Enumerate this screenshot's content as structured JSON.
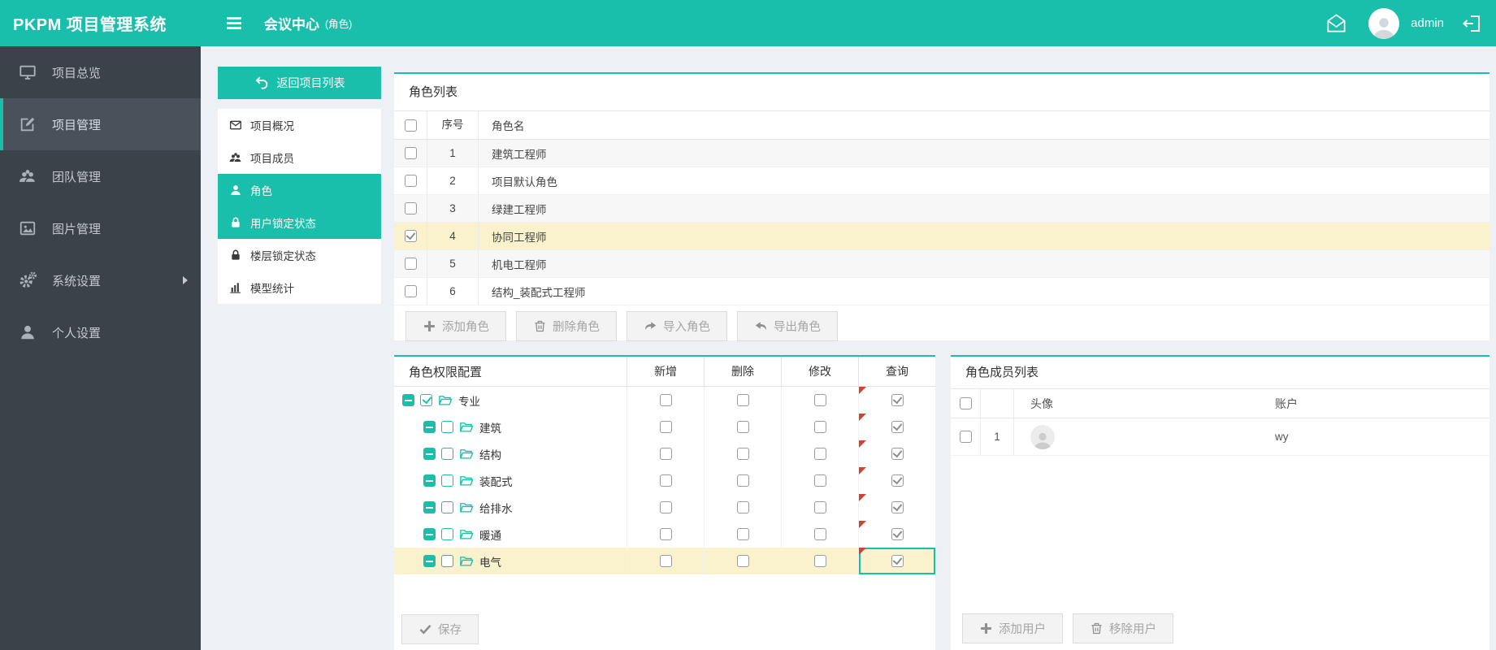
{
  "colors": {
    "accent": "#1abfab",
    "sidebar_bg": "#3b424a",
    "row_highlight": "#faf2cc",
    "flag_red": "#d2432f"
  },
  "topbar": {
    "brand": "PKPM 项目管理系统",
    "title": "会议中心",
    "title_suffix": "(角色)",
    "username": "admin"
  },
  "sidebar": {
    "items": [
      {
        "label": "项目总览",
        "icon": "monitor",
        "active": false,
        "has_submenu": false
      },
      {
        "label": "项目管理",
        "icon": "edit",
        "active": true,
        "has_submenu": false
      },
      {
        "label": "团队管理",
        "icon": "team",
        "active": false,
        "has_submenu": false
      },
      {
        "label": "图片管理",
        "icon": "image",
        "active": false,
        "has_submenu": false
      },
      {
        "label": "系统设置",
        "icon": "gears",
        "active": false,
        "has_submenu": true
      },
      {
        "label": "个人设置",
        "icon": "user",
        "active": false,
        "has_submenu": false
      }
    ]
  },
  "submenu": {
    "back_label": "返回项目列表",
    "items": [
      {
        "label": "项目概况",
        "icon": "mail",
        "active": false
      },
      {
        "label": "项目成员",
        "icon": "team",
        "active": false
      },
      {
        "label": "角色",
        "icon": "user",
        "active": true
      },
      {
        "label": "用户锁定状态",
        "icon": "lock",
        "active": true
      },
      {
        "label": "楼层锁定状态",
        "icon": "lock",
        "active": false
      },
      {
        "label": "模型统计",
        "icon": "chart",
        "active": false
      }
    ]
  },
  "role_list": {
    "title": "角色列表",
    "columns": [
      "序号",
      "角色名"
    ],
    "rows": [
      {
        "no": "1",
        "name": "建筑工程师",
        "checked": false,
        "selected": false
      },
      {
        "no": "2",
        "name": "项目默认角色",
        "checked": false,
        "selected": false
      },
      {
        "no": "3",
        "name": "绿建工程师",
        "checked": false,
        "selected": false
      },
      {
        "no": "4",
        "name": "协同工程师",
        "checked": true,
        "selected": true
      },
      {
        "no": "5",
        "name": "机电工程师",
        "checked": false,
        "selected": false
      },
      {
        "no": "6",
        "name": "结构_装配式工程师",
        "checked": false,
        "selected": false
      }
    ],
    "buttons": [
      {
        "label": "添加角色",
        "icon": "plus"
      },
      {
        "label": "删除角色",
        "icon": "trash"
      },
      {
        "label": "导入角色",
        "icon": "arrow-import"
      },
      {
        "label": "导出角色",
        "icon": "arrow-export"
      }
    ]
  },
  "permissions": {
    "title": "角色权限配置",
    "columns": [
      "新增",
      "删除",
      "修改",
      "查询"
    ],
    "rows": [
      {
        "label": "专业",
        "child": false,
        "checked": true,
        "add": false,
        "del": false,
        "mod": false,
        "query_checked": true,
        "flagged": true,
        "selected": false
      },
      {
        "label": "建筑",
        "child": true,
        "checked": false,
        "add": false,
        "del": false,
        "mod": false,
        "query_checked": true,
        "flagged": true,
        "selected": false
      },
      {
        "label": "结构",
        "child": true,
        "checked": false,
        "add": false,
        "del": false,
        "mod": false,
        "query_checked": true,
        "flagged": true,
        "selected": false
      },
      {
        "label": "装配式",
        "child": true,
        "checked": false,
        "add": false,
        "del": false,
        "mod": false,
        "query_checked": true,
        "flagged": true,
        "selected": false
      },
      {
        "label": "给排水",
        "child": true,
        "checked": false,
        "add": false,
        "del": false,
        "mod": false,
        "query_checked": true,
        "flagged": true,
        "selected": false
      },
      {
        "label": "暖通",
        "child": true,
        "checked": false,
        "add": false,
        "del": false,
        "mod": false,
        "query_checked": true,
        "flagged": true,
        "selected": false
      },
      {
        "label": "电气",
        "child": true,
        "checked": false,
        "add": false,
        "del": false,
        "mod": false,
        "query_checked": true,
        "flagged": true,
        "selected": true
      }
    ],
    "save_label": "保存",
    "save_icon": "check"
  },
  "members": {
    "title": "角色成员列表",
    "columns": [
      "头像",
      "账户"
    ],
    "rows": [
      {
        "no": "1",
        "account": "wy",
        "checked": false
      }
    ],
    "buttons": [
      {
        "label": "添加用户",
        "icon": "plus"
      },
      {
        "label": "移除用户",
        "icon": "trash"
      }
    ]
  }
}
